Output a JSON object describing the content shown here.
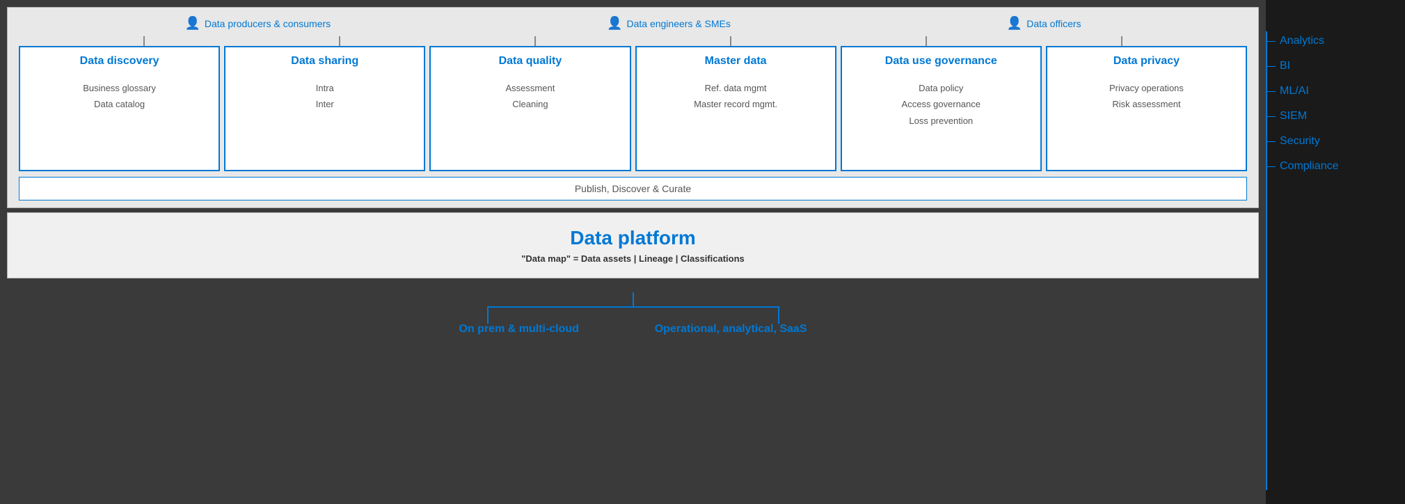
{
  "personas": [
    {
      "label": "Data producers & consumers"
    },
    {
      "label": "Data engineers & SMEs"
    },
    {
      "label": "Data officers"
    }
  ],
  "data_boxes": [
    {
      "title": "Data discovery",
      "items": [
        "Business glossary",
        "Data catalog"
      ]
    },
    {
      "title": "Data sharing",
      "items": [
        "Intra",
        "Inter"
      ]
    },
    {
      "title": "Data quality",
      "items": [
        "Assessment",
        "Cleaning"
      ]
    },
    {
      "title": "Master data",
      "items": [
        "Ref. data mgmt",
        "Master record mgmt."
      ]
    },
    {
      "title": "Data use governance",
      "items": [
        "Data policy",
        "Access governance",
        "Loss prevention"
      ]
    },
    {
      "title": "Data privacy",
      "items": [
        "Privacy operations",
        "Risk assessment"
      ]
    }
  ],
  "publish_bar": "Publish, Discover & Curate",
  "platform": {
    "title": "Data platform",
    "subtitle": "\"Data map\" = Data assets | Lineage | Classifications"
  },
  "bottom_labels": [
    "On prem & multi-cloud",
    "Operational, analytical, SaaS"
  ],
  "sidebar_items": [
    "Analytics",
    "BI",
    "ML/AI",
    "SIEM",
    "Security",
    "Compliance"
  ]
}
